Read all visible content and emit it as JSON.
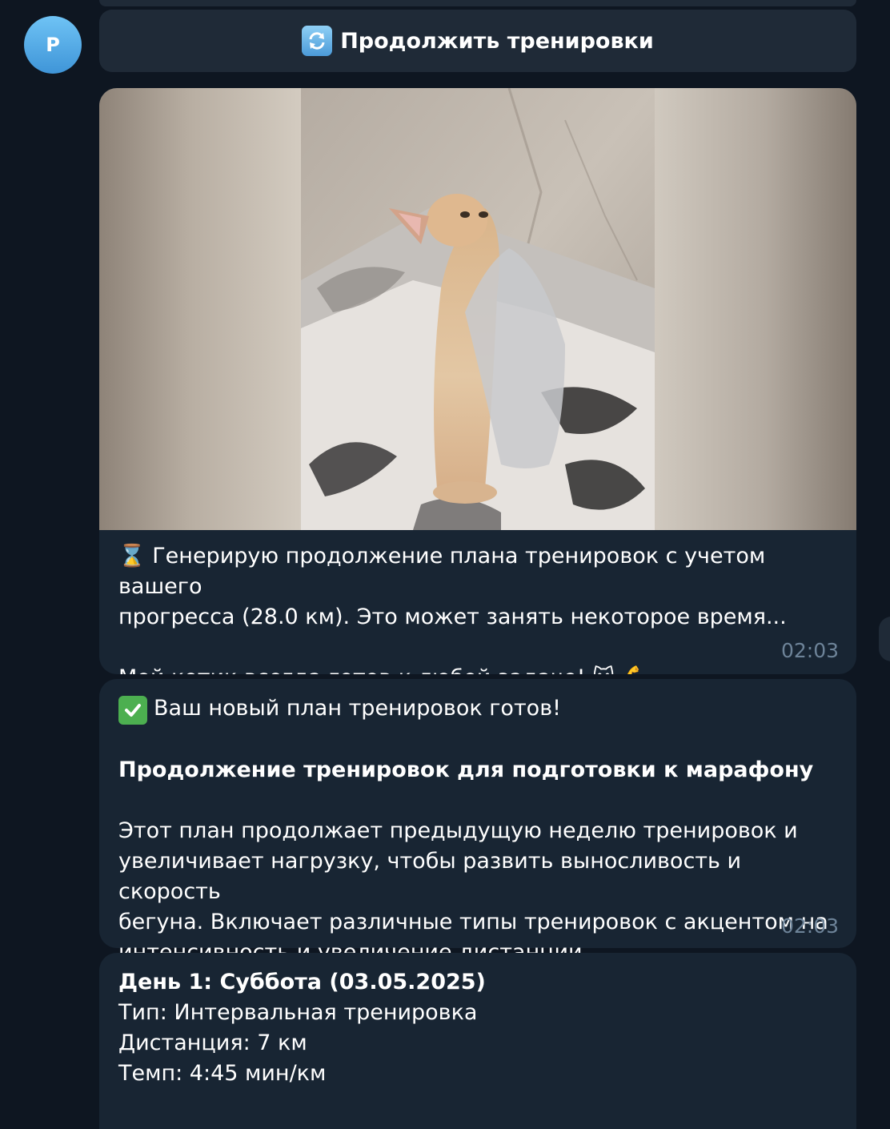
{
  "sender": {
    "avatar_letter": "P"
  },
  "inline_button": {
    "icon": "refresh-arrows-icon",
    "label": "Продолжить тренировки"
  },
  "message1": {
    "media": {
      "type": "video-thumbnail",
      "subject": "kitten-standing-on-hind-legs"
    },
    "line1": "Генерирую продолжение плана тренировок с учетом вашего",
    "line2": "прогресса (28.0 км). Это может занять некоторое время...",
    "line3": "Мой котик всегда готов к любой задаче!",
    "icons": [
      "hourglass-icon",
      "cat-face-icon",
      "flexed-biceps-icon"
    ],
    "time": "02:03"
  },
  "message2": {
    "intro": "Ваш новый план тренировок готов!",
    "title": "Продолжение тренировок для подготовки к марафону",
    "desc1": "Этот план продолжает предыдущую неделю тренировок и",
    "desc2": "увеличивает нагрузку, чтобы развить выносливость и скорость",
    "desc3": "бегуна. Включает различные типы тренировок с акцентом на",
    "desc4": "интенсивность и увеличение дистанции.",
    "icon": "check-mark-icon",
    "time": "02:03"
  },
  "message3": {
    "day": "День 1: Суббота (03.05.2025)",
    "type": "Тип: Интервальная тренировка",
    "distance": "Дистанция: 7 км",
    "pace": "Темп: 4:45 мин/км"
  },
  "colors": {
    "background": "#0e1621",
    "bubble": "#182533",
    "button": "#1f2a37",
    "timestamp": "#6d8398",
    "avatar": "#4da2e0"
  }
}
